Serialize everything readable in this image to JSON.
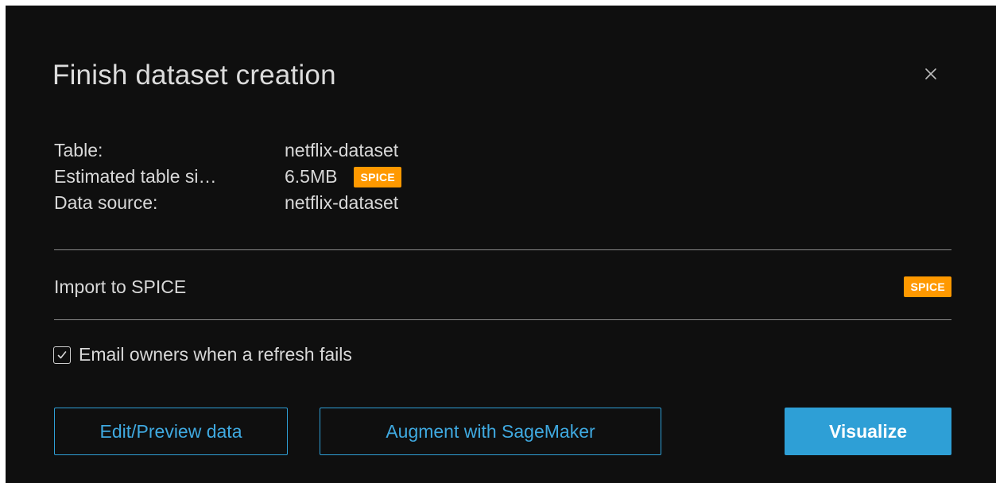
{
  "dialog": {
    "title": "Finish dataset creation",
    "close_glyph": "×"
  },
  "info": {
    "rows": [
      {
        "label": "Table:",
        "value": "netflix-dataset"
      },
      {
        "label": "Estimated table si…",
        "value": "6.5MB",
        "badge": "SPICE"
      },
      {
        "label": "Data source:",
        "value": "netflix-dataset"
      }
    ]
  },
  "import": {
    "label": "Import to SPICE",
    "badge": "SPICE"
  },
  "email_option": {
    "label": "Email owners when a refresh fails",
    "checked": true
  },
  "buttons": {
    "edit_preview": "Edit/Preview data",
    "augment": "Augment with SageMaker",
    "visualize": "Visualize"
  },
  "colors": {
    "background": "#0f0f0f",
    "badge": "#ff9900",
    "accent": "#2e9fd6",
    "text": "#d8d8d8"
  },
  "icons": {
    "close": "close-icon",
    "check": "checkmark-icon"
  }
}
